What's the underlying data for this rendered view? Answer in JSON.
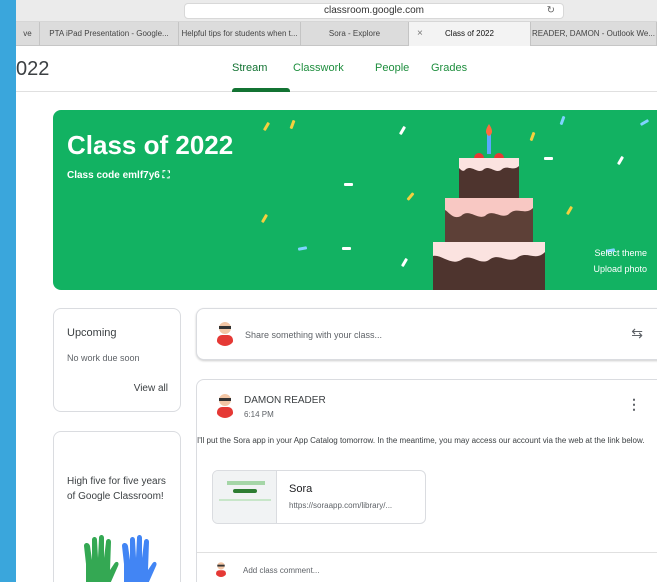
{
  "browser": {
    "url": "classroom.google.com",
    "tabs": [
      {
        "label": "ve"
      },
      {
        "label": "PTA iPad Presentation - Google..."
      },
      {
        "label": "Helpful tips for students when t..."
      },
      {
        "label": "Sora - Explore"
      },
      {
        "label": "Class of 2022",
        "active": true
      },
      {
        "label": "READER, DAMON - Outlook We..."
      }
    ]
  },
  "header": {
    "class_title_clip": "022",
    "nav": [
      {
        "label": "Stream",
        "active": true
      },
      {
        "label": "Classwork"
      },
      {
        "label": "People"
      },
      {
        "label": "Grades"
      }
    ]
  },
  "banner": {
    "title": "Class of 2022",
    "class_code_label": "Class code",
    "class_code": "emlf7y6",
    "select_theme": "Select theme",
    "upload_photo": "Upload photo",
    "color": "#12b262"
  },
  "upcoming": {
    "title": "Upcoming",
    "subtitle": "No work due soon",
    "link": "View all"
  },
  "highfive": {
    "text": "High five for five years of Google Classroom!"
  },
  "share": {
    "placeholder": "Share something with your class..."
  },
  "post": {
    "author": "DAMON READER",
    "time": "6:14 PM",
    "body": "I'll put the Sora app in your App Catalog tomorrow. In the meantime, you may access our account via the web at the link below.",
    "attachment_title": "Sora",
    "attachment_url": "https://soraapp.com/library/...",
    "comment_placeholder": "Add class comment..."
  },
  "colors": {
    "accent": "#137333",
    "frame": "#3aa6dc"
  }
}
